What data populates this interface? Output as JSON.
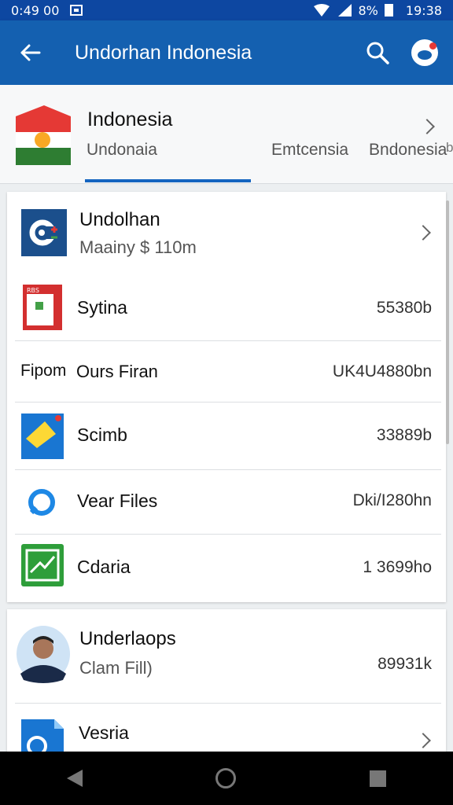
{
  "status_bar": {
    "time_left": "0:49 00",
    "battery": "8%",
    "time_right": "19:38"
  },
  "app_bar": {
    "title": "Undorhan Indonesia"
  },
  "country": {
    "name": "Indonesia",
    "tabs": [
      "Undonaia",
      "Emtcensia",
      "Bndonesia"
    ],
    "edge_letter": "b"
  },
  "list": {
    "items": [
      {
        "label": "Undolhan",
        "sub": "Maainy $ 110m",
        "value": ""
      },
      {
        "label": "Sytina",
        "sub": "",
        "value": "55380b"
      },
      {
        "label": "Ours Firan",
        "sub": "",
        "prefix": "Fipom",
        "value": "UK4U4880bn"
      },
      {
        "label": "Scimb",
        "sub": "",
        "value": "33889b"
      },
      {
        "label": "Vear Files",
        "sub": "",
        "value": "Dki/I280hn"
      },
      {
        "label": "Cdaria",
        "sub": "",
        "value": "1 3699ho"
      }
    ]
  },
  "card2": {
    "items": [
      {
        "label": "Underlaops",
        "sub": "Clam Fill)",
        "value": "89931k"
      },
      {
        "label": "Vesria",
        "sub": "",
        "value": ""
      }
    ]
  },
  "icon_texts": {
    "sytina_badge": "RBS"
  }
}
